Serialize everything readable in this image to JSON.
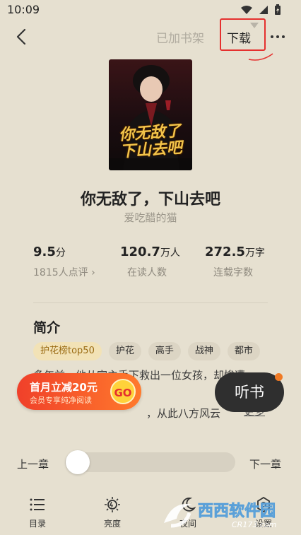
{
  "status": {
    "time": "10:09"
  },
  "header": {
    "shelf_label": "已加书架",
    "download_label": "下载"
  },
  "book": {
    "cover_title_line1": "你无敌了",
    "cover_title_line2": "下山去吧",
    "title": "你无敌了，下山去吧",
    "author": "爱吃醋的猫"
  },
  "stats": [
    {
      "value": "9.5",
      "unit": "分",
      "label": "1815人点评 ›"
    },
    {
      "value": "120.7",
      "unit": "万人",
      "label": "在读人数"
    },
    {
      "value": "272.5",
      "unit": "万字",
      "label": "连载字数"
    }
  ],
  "intro": {
    "heading": "简介",
    "tags": [
      "护花榜top50",
      "护花",
      "高手",
      "战神",
      "都市"
    ],
    "line1": "多年前，他从家主手下救出一位女孩，却惨遭",
    "line2": "",
    "line3": "，从此八方风云",
    "more_label": "更多"
  },
  "promo": {
    "line1": "首月立减20元",
    "line2": "会员专享纯净阅读",
    "go_label": "GO"
  },
  "listen_label": "听书",
  "chapter": {
    "prev_label": "上一章",
    "next_label": "下一章",
    "progress": 0
  },
  "nav": [
    {
      "label": "目录",
      "icon": "list-icon"
    },
    {
      "label": "亮度",
      "icon": "brightness-icon"
    },
    {
      "label": "夜间",
      "icon": "moon-icon"
    },
    {
      "label": "设置",
      "icon": "settings-icon"
    }
  ],
  "watermark": {
    "text": "西西软件园",
    "sub": "CR173.com"
  },
  "colors": {
    "background": "#e6e0d0",
    "accent_red": "#e5302e",
    "promo_orange": "#ff7a2c",
    "listen_bg": "#2f2f2f"
  }
}
